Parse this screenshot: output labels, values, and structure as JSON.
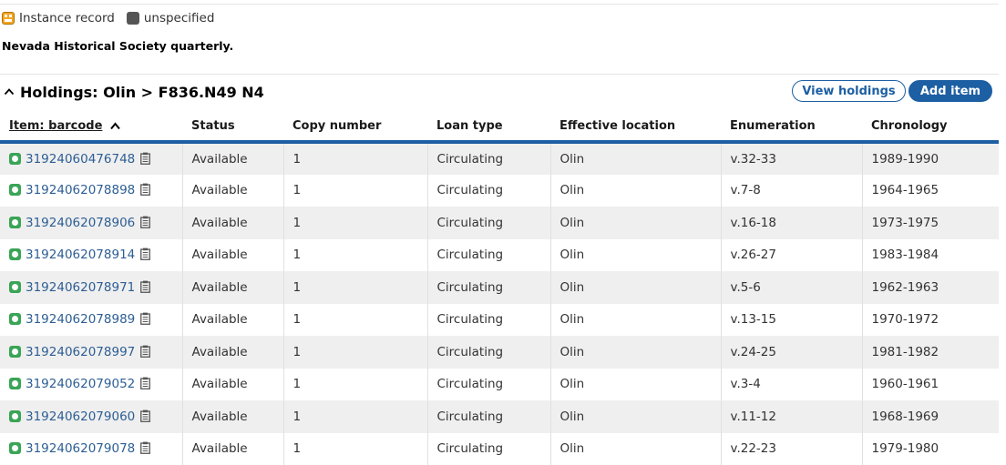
{
  "legend": {
    "instance_label": "Instance record",
    "unspecified_label": "unspecified"
  },
  "instance_title": "Nevada Historical Society quarterly.",
  "holdings": {
    "title": "Holdings: Olin > F836.N49 N4",
    "view_holdings_label": "View holdings",
    "add_item_label": "Add item"
  },
  "columns": {
    "barcode": "Item: barcode",
    "status": "Status",
    "copy_number": "Copy number",
    "loan_type": "Loan type",
    "effective_location": "Effective location",
    "enumeration": "Enumeration",
    "chronology": "Chronology"
  },
  "items": [
    {
      "barcode": "31924060476748",
      "status": "Available",
      "copy_number": "1",
      "loan_type": "Circulating",
      "effective_location": "Olin",
      "enumeration": "v.32-33",
      "chronology": "1989-1990"
    },
    {
      "barcode": "31924062078898",
      "status": "Available",
      "copy_number": "1",
      "loan_type": "Circulating",
      "effective_location": "Olin",
      "enumeration": "v.7-8",
      "chronology": "1964-1965"
    },
    {
      "barcode": "31924062078906",
      "status": "Available",
      "copy_number": "1",
      "loan_type": "Circulating",
      "effective_location": "Olin",
      "enumeration": "v.16-18",
      "chronology": "1973-1975"
    },
    {
      "barcode": "31924062078914",
      "status": "Available",
      "copy_number": "1",
      "loan_type": "Circulating",
      "effective_location": "Olin",
      "enumeration": "v.26-27",
      "chronology": "1983-1984"
    },
    {
      "barcode": "31924062078971",
      "status": "Available",
      "copy_number": "1",
      "loan_type": "Circulating",
      "effective_location": "Olin",
      "enumeration": "v.5-6",
      "chronology": "1962-1963"
    },
    {
      "barcode": "31924062078989",
      "status": "Available",
      "copy_number": "1",
      "loan_type": "Circulating",
      "effective_location": "Olin",
      "enumeration": "v.13-15",
      "chronology": "1970-1972"
    },
    {
      "barcode": "31924062078997",
      "status": "Available",
      "copy_number": "1",
      "loan_type": "Circulating",
      "effective_location": "Olin",
      "enumeration": "v.24-25",
      "chronology": "1981-1982"
    },
    {
      "barcode": "31924062079052",
      "status": "Available",
      "copy_number": "1",
      "loan_type": "Circulating",
      "effective_location": "Olin",
      "enumeration": "v.3-4",
      "chronology": "1960-1961"
    },
    {
      "barcode": "31924062079060",
      "status": "Available",
      "copy_number": "1",
      "loan_type": "Circulating",
      "effective_location": "Olin",
      "enumeration": "v.11-12",
      "chronology": "1968-1969"
    },
    {
      "barcode": "31924062079078",
      "status": "Available",
      "copy_number": "1",
      "loan_type": "Circulating",
      "effective_location": "Olin",
      "enumeration": "v.22-23",
      "chronology": "1979-1980"
    }
  ],
  "icons": {
    "instance": "instance-record-icon",
    "unspecified": "unspecified-icon",
    "collapse": "chevron-up-icon",
    "sort": "sort-ascending-icon",
    "status": "available-status-icon",
    "copy": "clipboard-icon"
  },
  "colors": {
    "accent": "#1d5fa3",
    "link": "#2c5e94",
    "available": "#3aa457",
    "instance": "#f5a623",
    "unspecified": "#555555",
    "row_alt": "#efefef"
  }
}
